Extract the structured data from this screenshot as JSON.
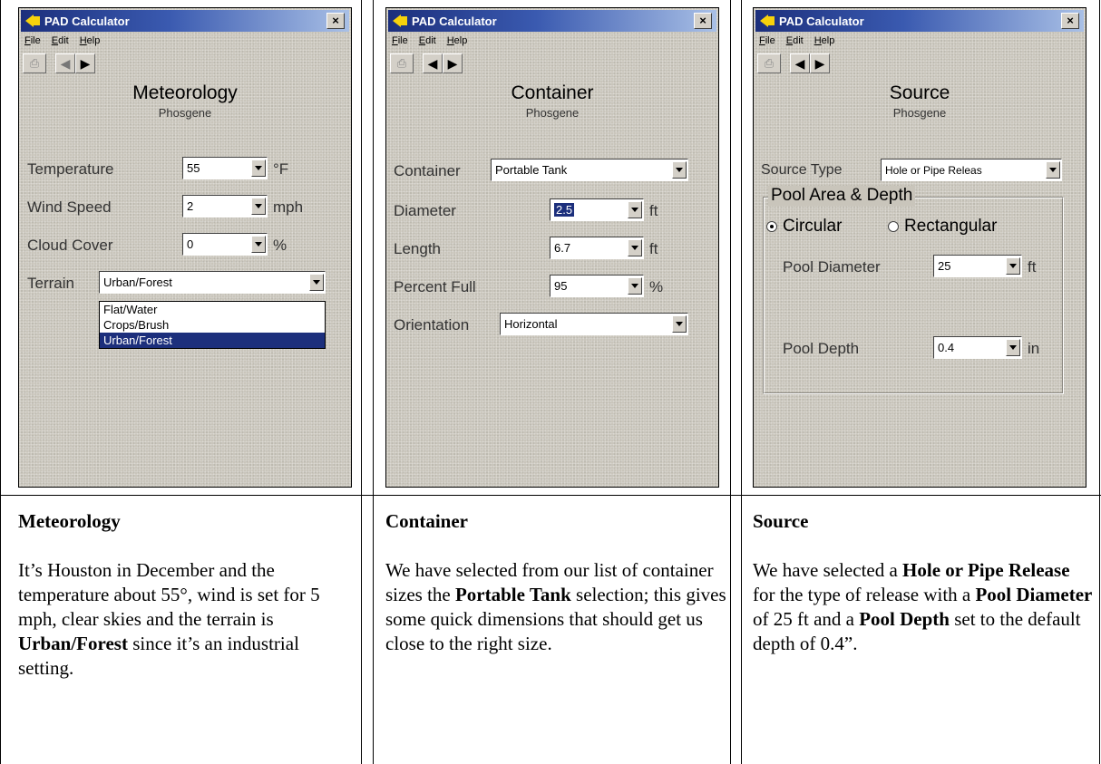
{
  "window_title": "PAD Calculator",
  "menu": [
    "File",
    "Edit",
    "Help"
  ],
  "chemical": "Phosgene",
  "meteorology": {
    "heading": "Meteorology",
    "temperature_label": "Temperature",
    "temperature_value": "55",
    "temperature_unit": "°F",
    "wind_label": "Wind Speed",
    "wind_value": "2",
    "wind_unit": "mph",
    "cloud_label": "Cloud Cover",
    "cloud_value": "0",
    "cloud_unit": "%",
    "terrain_label": "Terrain",
    "terrain_value": "Urban/Forest",
    "terrain_options": [
      "Flat/Water",
      "Crops/Brush",
      "Urban/Forest"
    ]
  },
  "container": {
    "heading": "Container",
    "container_label": "Container",
    "container_value": "Portable Tank",
    "diameter_label": "Diameter",
    "diameter_value": "2.5",
    "diameter_unit": "ft",
    "length_label": "Length",
    "length_value": "6.7",
    "length_unit": "ft",
    "percent_label": "Percent Full",
    "percent_value": "95",
    "percent_unit": "%",
    "orientation_label": "Orientation",
    "orientation_value": "Horizontal"
  },
  "source": {
    "heading": "Source",
    "type_label": "Source Type",
    "type_value": "Hole or Pipe Releas",
    "group_title": "Pool Area & Depth",
    "radio_circular": "Circular",
    "radio_rectangular": "Rectangular",
    "pool_diameter_label": "Pool Diameter",
    "pool_diameter_value": "25",
    "pool_diameter_unit": "ft",
    "pool_depth_label": "Pool Depth",
    "pool_depth_value": "0.4",
    "pool_depth_unit": "in"
  },
  "captions": {
    "meteorology": {
      "title": "Meteorology",
      "text_1": "It’s Houston in December and the temperature about 55°, wind is set for 5 mph, clear skies and the terrain is ",
      "bold_1": "Urban/Forest",
      "text_2": " since it’s an industrial setting."
    },
    "container": {
      "title": "Container",
      "text_1": "We have selected from our list of container sizes the ",
      "bold_1": "Portable Tank",
      "text_2": " selection; this gives some quick dimensions that should get us close to the right size."
    },
    "source": {
      "title": "Source",
      "text_1": "We have selected a ",
      "bold_1": "Hole or Pipe Release",
      "text_2": " for the type of release with a ",
      "bold_2": "Pool Diameter",
      "text_3": " of 25 ft and a ",
      "bold_3": "Pool Depth",
      "text_4": " set to the default depth of 0.4”."
    }
  }
}
